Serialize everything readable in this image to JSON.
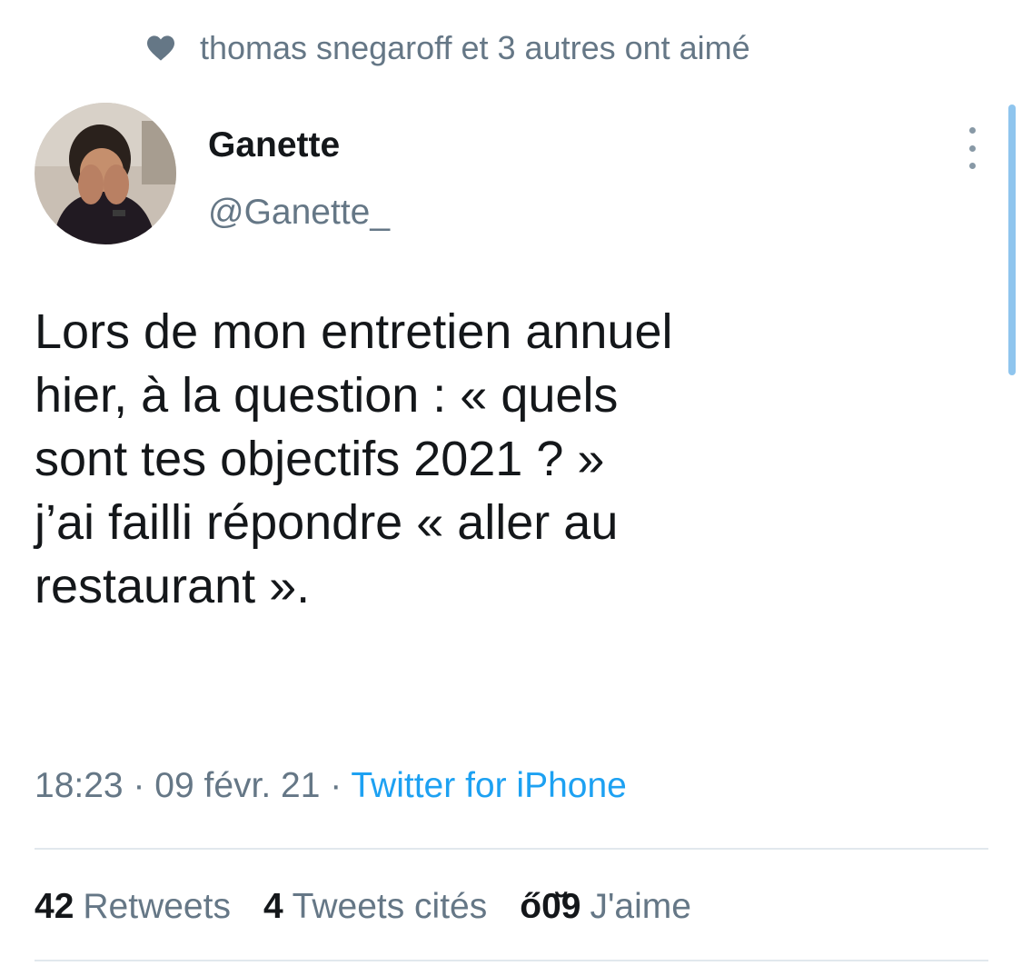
{
  "social_context": {
    "icon": "heart-icon",
    "text": "thomas snegaroff et 3 autres ont aimé"
  },
  "author": {
    "display_name": "Ganette",
    "handle": "@Ganette_",
    "avatar_icon": "avatar-photo"
  },
  "tweet": {
    "lines": [
      "Lors de mon entretien annuel",
      "hier, à la question : « quels",
      "sont tes objectifs 2021 ? »",
      "j’ai failli répondre « aller au",
      "restaurant »."
    ],
    "time": "18:23",
    "separator": " · ",
    "date": "09 févr. 21",
    "source": "Twitter for iPhone"
  },
  "stats": {
    "retweets_count": "42",
    "retweets_label": "Retweets",
    "quotes_count": "4",
    "quotes_label": "Tweets cités",
    "likes_count": "ő0̆9",
    "likes_label": "J'aime"
  },
  "menu": {
    "icon": "more-vertical-icon"
  },
  "colors": {
    "primary_text": "#14171a",
    "secondary_text": "#657786",
    "link": "#1da1f2",
    "divider": "#e1e8ed",
    "scrollbar": "#8fc5ee"
  }
}
